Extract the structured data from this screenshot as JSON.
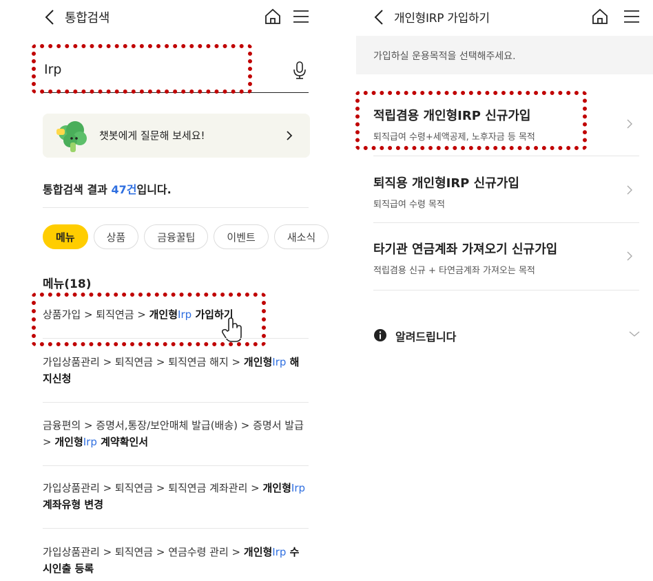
{
  "left": {
    "header": {
      "title": "통합검색"
    },
    "search": {
      "value": "Irp"
    },
    "chatbot": {
      "text": "챗봇에게 질문해 보세요!"
    },
    "result_summary": {
      "prefix": "통합검색 결과 ",
      "count": "47건",
      "suffix": "입니다."
    },
    "chips": [
      "메뉴",
      "상품",
      "금융꿀팁",
      "이벤트",
      "새소식"
    ],
    "section_title": "메뉴(18)",
    "menu_items": [
      {
        "path": "상품가입 > 퇴직연금 > ",
        "bold": "개인형",
        "hl": "Irp",
        "tail": " 가입하기"
      },
      {
        "path": "가입상품관리 > 퇴직연금 > 퇴직연금 해지 > ",
        "bold": "개인형",
        "hl": "Irp",
        "tail": " 해지신청"
      },
      {
        "path": "금융편의 > 증명서,통장/보안매체 발급(배송) > 증명서 발급 > ",
        "bold": "개인형",
        "hl": "Irp",
        "tail": " 계약확인서"
      },
      {
        "path": "가입상품관리 > 퇴직연금 > 퇴직연금 계좌관리 > ",
        "bold": "개인형",
        "hl": "Irp",
        "tail": " 계좌유형 변경"
      },
      {
        "path": "가입상품관리 > 퇴직연금 > 연금수령 관리 > ",
        "bold": "개인형",
        "hl": "Irp",
        "tail": " 수시인출 등록"
      }
    ]
  },
  "right": {
    "header": {
      "title": "개인형IRP 가입하기"
    },
    "notice": "가입하실 운용목적을 선택해주세요.",
    "options": [
      {
        "title": "적립겸용 개인형IRP 신규가입",
        "subtitle": "퇴직급여 수령+세액공제, 노후자금 등 목적"
      },
      {
        "title": "퇴직용 개인형IRP 신규가입",
        "subtitle": "퇴직급여 수령 목적"
      },
      {
        "title": "타기관 연금계좌 가져오기 신규가입",
        "subtitle": "적립겸용 신규 + 타연금계좌 가져오는 목적"
      }
    ],
    "info_label": "알려드립니다"
  },
  "colors": {
    "accent_yellow": "#ffcd00",
    "highlight_blue": "#2f6fe0",
    "annotation_red": "#c00000"
  }
}
